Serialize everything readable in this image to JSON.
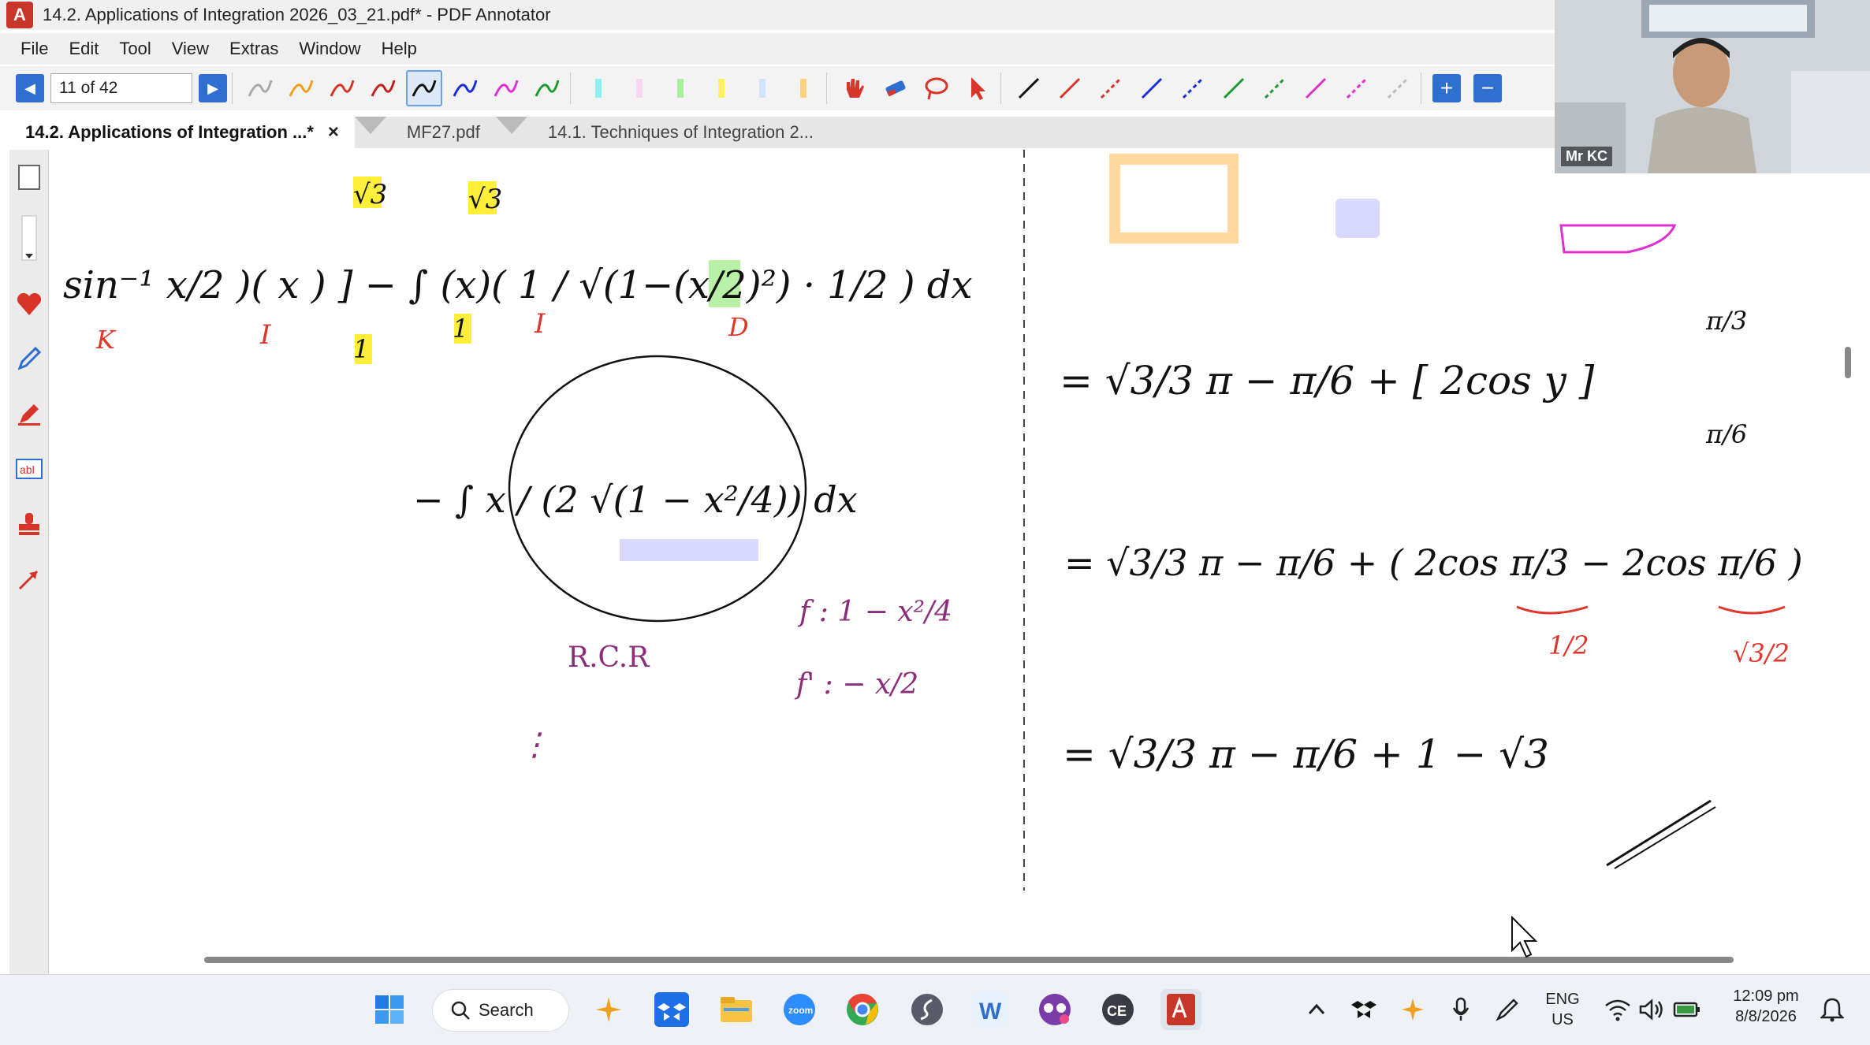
{
  "window": {
    "title": "14.2. Applications of Integration 2026_03_21.pdf* - PDF Annotator"
  },
  "menu": [
    "File",
    "Edit",
    "Tool",
    "View",
    "Extras",
    "Window",
    "Help"
  ],
  "toolbar": {
    "page_field": "11 of 42"
  },
  "tabs": [
    {
      "label": "14.2. Applications of Integration ...*",
      "close": "×"
    },
    {
      "label": "MF27.pdf"
    },
    {
      "label": "14.1. Techniques of Integration 2..."
    }
  ],
  "webcam": {
    "name": "Mr KC"
  },
  "handwriting": {
    "left": {
      "top_line": "sin⁻¹ x/2 )( x ) ]  −  ∫ (x)( 1 / √(1−(x/2)²) · 1/2 ) dx",
      "limit_top": "√3",
      "limit_bottom": "1",
      "labels": [
        "K",
        "I",
        "I",
        "D"
      ],
      "middle": "− ∫ x / (2 √(1 − x²/4)) dx",
      "rcr": "R.C.R",
      "f_line": "f : 1 − x²/4",
      "fp_line": "f' : − x/2",
      "dots": "⋮"
    },
    "right": {
      "line1": "= √3/3 π − π/6 + [ 2cos y ]",
      "line1_upper": "π/3",
      "line1_lower": "π/6",
      "line2": "= √3/3 π − π/6 + ( 2cos π/3 − 2cos π/6 )",
      "line2_note_a": "1/2",
      "line2_note_b": "√3/2",
      "line3": "= √3/3 π − π/6 + 1 − √3"
    }
  },
  "taskbar": {
    "search_label": "Search",
    "lang_top": "ENG",
    "lang_bottom": "US",
    "time": "12:09 pm",
    "date": "8/8/2026"
  },
  "colors": {
    "accent": "#2f6fd0",
    "ink_black": "#111111",
    "ink_red": "#e0352b",
    "ink_green": "#2e8b2e",
    "ink_purple": "#8b2d7a",
    "highlight_yellow": "#ffef3a",
    "highlight_orange": "#ffd9a0",
    "highlight_lavender": "#d9d9ff"
  }
}
